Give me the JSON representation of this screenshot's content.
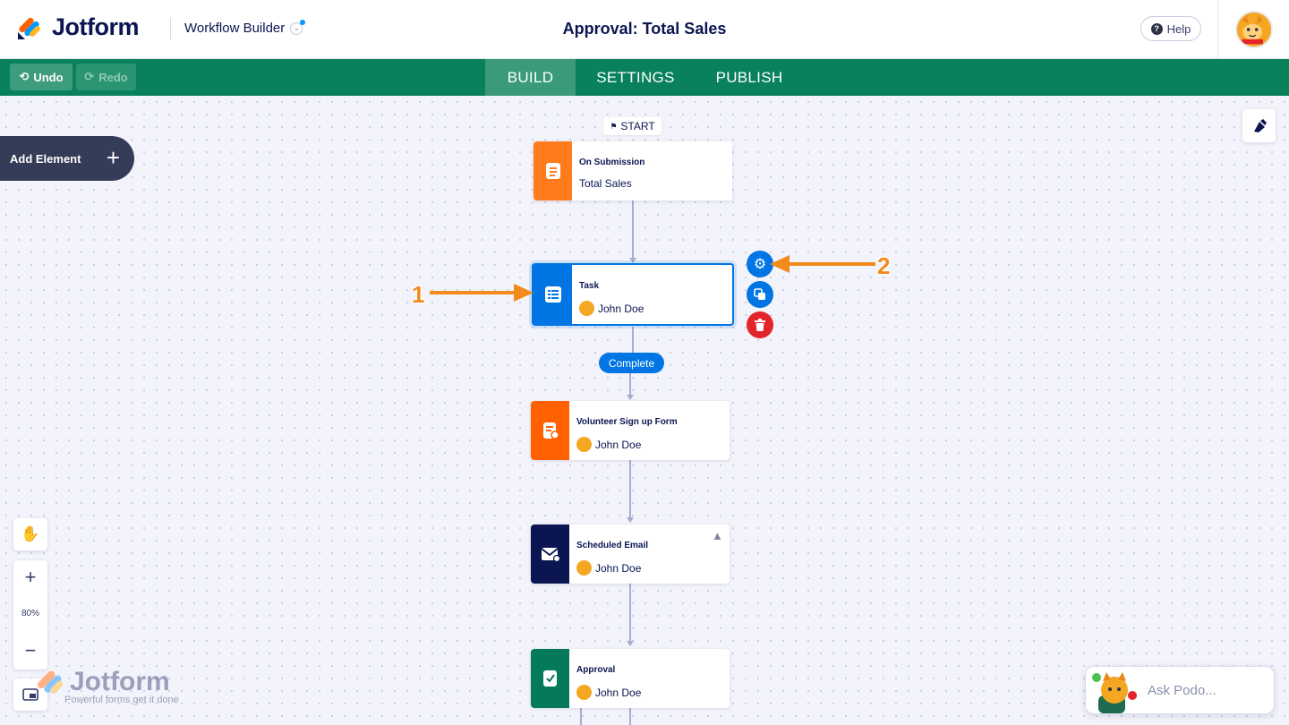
{
  "header": {
    "brand": "Jotform",
    "product": "Workflow Builder",
    "title": "Approval: Total Sales",
    "help_label": "Help"
  },
  "navbar": {
    "undo_label": "Undo",
    "redo_label": "Redo",
    "tabs": [
      {
        "label": "BUILD",
        "active": true
      },
      {
        "label": "SETTINGS",
        "active": false
      },
      {
        "label": "PUBLISH",
        "active": false
      }
    ]
  },
  "canvas": {
    "add_element_label": "Add Element",
    "start_label": "START",
    "complete_label": "Complete",
    "zoom_level": "80%",
    "nodes": [
      {
        "title": "On Submission",
        "subtitle": "Total Sales",
        "color": "#ff7b1c",
        "icon": "form-icon"
      },
      {
        "title": "Task",
        "subtitle": "John Doe",
        "color": "#0075e3",
        "icon": "task-list-icon"
      },
      {
        "title": "Volunteer Sign up Form",
        "subtitle": "John Doe",
        "color": "#ff6100",
        "icon": "form-assign-icon"
      },
      {
        "title": "Scheduled Email",
        "subtitle": "John Doe",
        "color": "#0a1551",
        "icon": "email-schedule-icon"
      },
      {
        "title": "Approval",
        "subtitle": "John Doe",
        "color": "#047a5b",
        "icon": "approval-icon"
      }
    ],
    "node_actions": [
      {
        "name": "settings",
        "color": "#0075e3"
      },
      {
        "name": "duplicate",
        "color": "#0075e3"
      },
      {
        "name": "delete",
        "color": "#e3242b"
      }
    ]
  },
  "annotations": [
    "1",
    "2"
  ],
  "watermark": {
    "brand": "Jotform",
    "tagline": "Powerful forms get it done"
  },
  "assistant": {
    "label": "Ask Podo..."
  }
}
